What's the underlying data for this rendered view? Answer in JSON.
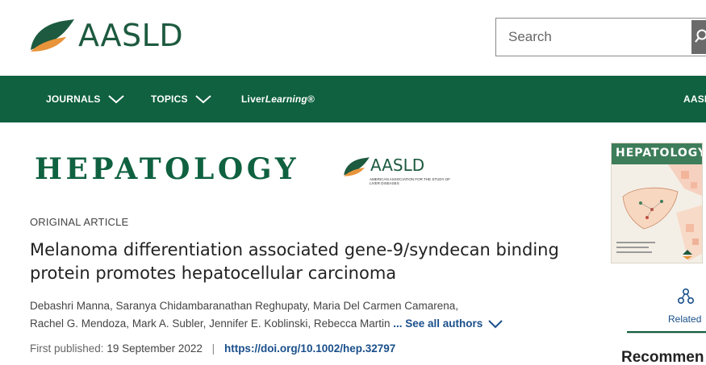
{
  "header": {
    "logo_text": "AASLD",
    "search_placeholder": "Search"
  },
  "nav": {
    "journals": "JOURNALS",
    "topics": "TOPICS",
    "liver_learning_prefix": "Liver",
    "liver_learning_italic": "Learning",
    "liver_learning_suffix": "®",
    "aasld": "AASL"
  },
  "journal": {
    "title": "HEPATOLOGY",
    "publisher_logo_text": "AASLD",
    "publisher_tagline": "American Association for the Study of Liver Diseases"
  },
  "article": {
    "type": "ORIGINAL ARTICLE",
    "title": "Melanoma differentiation associated gene-9/syndecan binding protein promotes hepatocellular carcinoma",
    "authors_line1": "Debashri Manna, Saranya Chidambaranathan Reghupaty, Maria Del Carmen Camarena,",
    "authors_line2": "Rachel G. Mendoza, Mark A. Subler, Jennifer E. Koblinski, Rebecca Martin",
    "see_all": "... See all authors",
    "first_published_label": "First published:",
    "first_published_date": "19 September 2022",
    "separator": "|",
    "doi": "https://doi.org/10.1002/hep.32797"
  },
  "rail": {
    "cover_title": "HEPATOLOGY",
    "related_label": "Related",
    "recommended_label": "Recommen"
  },
  "colors": {
    "brand_green": "#0f6140",
    "logo_orange": "#e8943a",
    "link_blue": "#1a4f8b"
  },
  "icons": {
    "search": "search-icon",
    "chevron": "chevron-down-icon",
    "related": "related-nodes-icon"
  }
}
